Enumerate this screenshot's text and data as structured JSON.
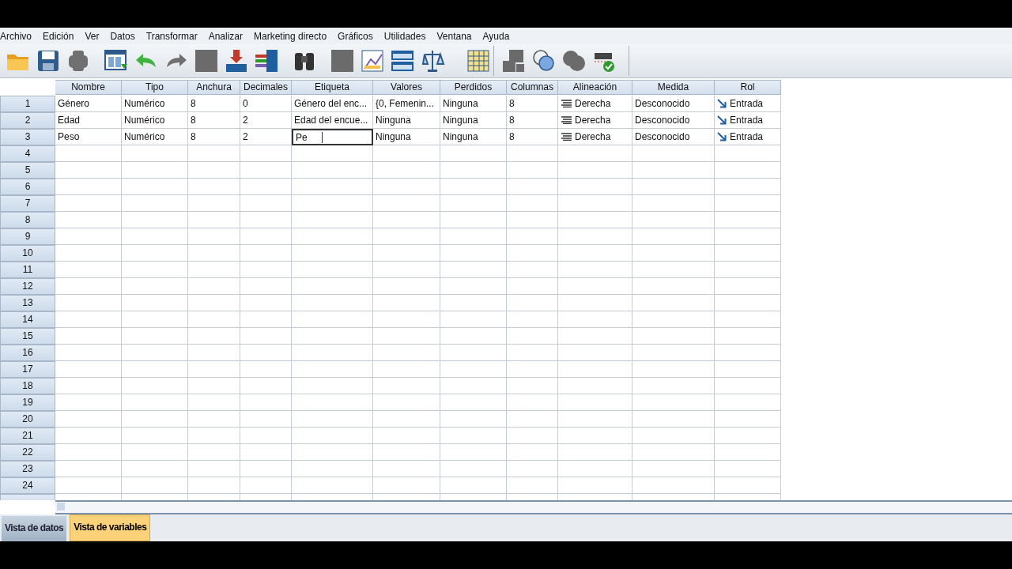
{
  "menu": [
    "Archivo",
    "Edición",
    "Ver",
    "Datos",
    "Transformar",
    "Analizar",
    "Marketing directo",
    "Gráficos",
    "Utilidades",
    "Ventana",
    "Ayuda"
  ],
  "toolbar": [
    {
      "kind": "folder",
      "disabled": false
    },
    {
      "kind": "disk",
      "disabled": false
    },
    {
      "kind": "printer",
      "disabled": true
    },
    {
      "kind": "dialog",
      "disabled": false
    },
    {
      "kind": "undo",
      "disabled": false
    },
    {
      "kind": "redo",
      "disabled": true
    },
    {
      "kind": "goto",
      "disabled": true
    },
    {
      "kind": "import",
      "disabled": false
    },
    {
      "kind": "table",
      "disabled": false
    },
    {
      "kind": "binoculars",
      "disabled": false
    },
    {
      "kind": "insert",
      "disabled": true
    },
    {
      "kind": "chart",
      "disabled": false
    },
    {
      "kind": "split",
      "disabled": false
    },
    {
      "kind": "scales",
      "disabled": false
    },
    {
      "kind": "grid",
      "disabled": false
    },
    {
      "kind": "labels",
      "disabled": true
    },
    {
      "kind": "sets",
      "disabled": false
    },
    {
      "kind": "showall",
      "disabled": true
    },
    {
      "kind": "spell",
      "disabled": false
    }
  ],
  "table": {
    "columns": [
      {
        "label": "Nombre",
        "kind": "text"
      },
      {
        "label": "Tipo",
        "kind": "text"
      },
      {
        "label": "Anchura",
        "kind": "text"
      },
      {
        "label": "Decimales",
        "kind": "text"
      },
      {
        "label": "Etiqueta",
        "kind": "text"
      },
      {
        "label": "Valores",
        "kind": "text"
      },
      {
        "label": "Perdidos",
        "kind": "text"
      },
      {
        "label": "Columnas",
        "kind": "text"
      },
      {
        "label": "Alineación",
        "kind": "align"
      },
      {
        "label": "Medida",
        "kind": "text"
      },
      {
        "label": "Rol",
        "kind": "role"
      }
    ],
    "rows": [
      {
        "number": "1",
        "cells": [
          {
            "text": "Género",
            "editing": false
          },
          {
            "text": "Numérico",
            "editing": false
          },
          {
            "text": "8",
            "editing": false
          },
          {
            "text": "0",
            "editing": false
          },
          {
            "text": "Género del enc...",
            "editing": false
          },
          {
            "text": "{0, Femenin...",
            "editing": false
          },
          {
            "text": "Ninguna",
            "editing": false
          },
          {
            "text": "8",
            "editing": false
          },
          {
            "text": "Derecha",
            "editing": false
          },
          {
            "text": "Desconocido",
            "editing": false
          },
          {
            "text": "Entrada",
            "editing": false
          }
        ]
      },
      {
        "number": "2",
        "cells": [
          {
            "text": "Edad",
            "editing": false
          },
          {
            "text": "Numérico",
            "editing": false
          },
          {
            "text": "8",
            "editing": false
          },
          {
            "text": "2",
            "editing": false
          },
          {
            "text": "Edad del encue...",
            "editing": false
          },
          {
            "text": "Ninguna",
            "editing": false
          },
          {
            "text": "Ninguna",
            "editing": false
          },
          {
            "text": "8",
            "editing": false
          },
          {
            "text": "Derecha",
            "editing": false
          },
          {
            "text": "Desconocido",
            "editing": false
          },
          {
            "text": "Entrada",
            "editing": false
          }
        ]
      },
      {
        "number": "3",
        "cells": [
          {
            "text": "Peso",
            "editing": false
          },
          {
            "text": "Numérico",
            "editing": false
          },
          {
            "text": "8",
            "editing": false
          },
          {
            "text": "2",
            "editing": false
          },
          {
            "text": "Pe",
            "editing": true
          },
          {
            "text": "Ninguna",
            "editing": false
          },
          {
            "text": "Ninguna",
            "editing": false
          },
          {
            "text": "8",
            "editing": false
          },
          {
            "text": "Derecha",
            "editing": false
          },
          {
            "text": "Desconocido",
            "editing": false
          },
          {
            "text": "Entrada",
            "editing": false
          }
        ]
      },
      {
        "number": "4",
        "cells": []
      },
      {
        "number": "5",
        "cells": []
      },
      {
        "number": "6",
        "cells": []
      },
      {
        "number": "7",
        "cells": []
      },
      {
        "number": "8",
        "cells": []
      },
      {
        "number": "9",
        "cells": []
      },
      {
        "number": "10",
        "cells": []
      },
      {
        "number": "11",
        "cells": []
      },
      {
        "number": "12",
        "cells": []
      },
      {
        "number": "13",
        "cells": []
      },
      {
        "number": "14",
        "cells": []
      },
      {
        "number": "15",
        "cells": []
      },
      {
        "number": "16",
        "cells": []
      },
      {
        "number": "17",
        "cells": []
      },
      {
        "number": "18",
        "cells": []
      },
      {
        "number": "19",
        "cells": []
      },
      {
        "number": "20",
        "cells": []
      },
      {
        "number": "21",
        "cells": []
      },
      {
        "number": "22",
        "cells": []
      },
      {
        "number": "23",
        "cells": []
      },
      {
        "number": "24",
        "cells": []
      }
    ]
  },
  "tabs": [
    {
      "label": "Vista de datos",
      "selected": false
    },
    {
      "label": "Vista de variables",
      "selected": true
    }
  ]
}
